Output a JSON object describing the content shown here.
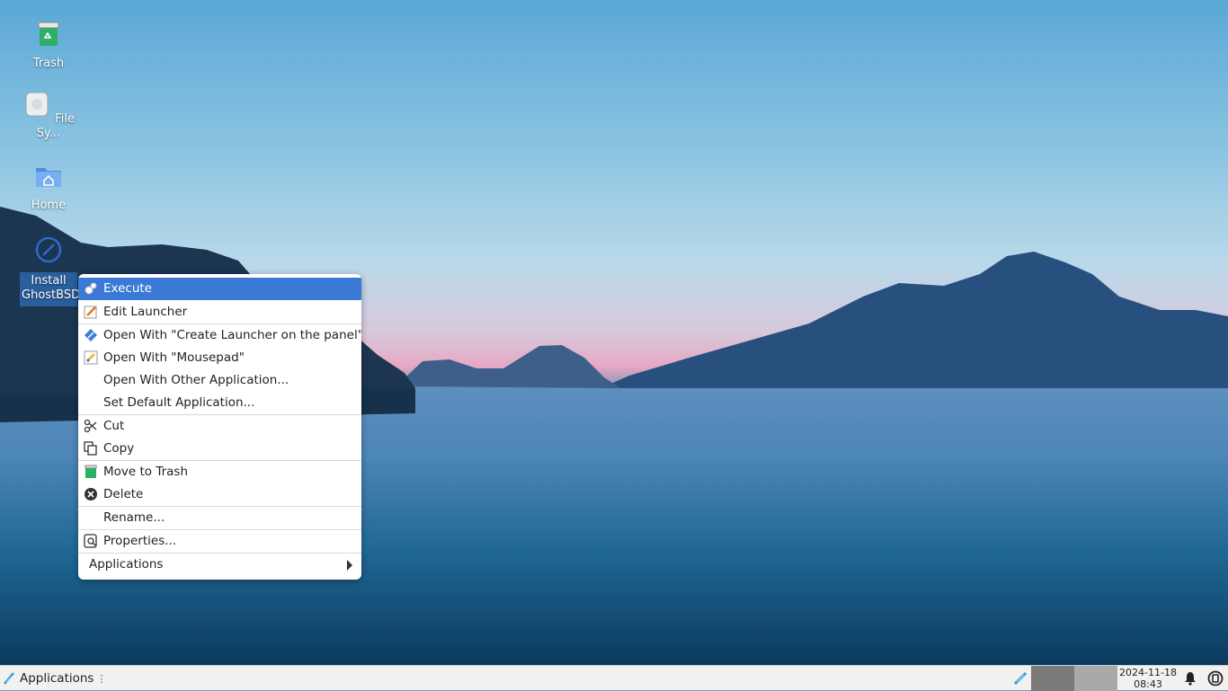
{
  "desktop": {
    "icons": [
      {
        "label": "Trash",
        "icon": "trash-icon"
      },
      {
        "label": "File Sy...",
        "icon": "drive-icon"
      },
      {
        "label": "Home",
        "icon": "home-folder-icon"
      },
      {
        "label": "Install GhostBSD",
        "icon": "ghostbsd-installer-icon",
        "selected": true
      }
    ]
  },
  "context_menu": {
    "items": [
      {
        "label": "Execute",
        "icon": "gears-icon",
        "highlighted": true
      },
      {
        "label": "Edit Launcher",
        "icon": "edit-icon"
      },
      {
        "label": "Open With \"Create Launcher on the panel\"",
        "icon": "launcher-icon"
      },
      {
        "label": "Open With \"Mousepad\"",
        "icon": "mousepad-icon"
      },
      {
        "label": "Open With Other Application...",
        "icon": ""
      },
      {
        "label": "Set Default Application...",
        "icon": ""
      },
      {
        "label": "Cut",
        "icon": "scissors-icon"
      },
      {
        "label": "Copy",
        "icon": "copy-icon"
      },
      {
        "label": "Move to Trash",
        "icon": "trash-icon"
      },
      {
        "label": "Delete",
        "icon": "delete-icon"
      },
      {
        "label": "Rename...",
        "icon": ""
      },
      {
        "label": "Properties...",
        "icon": "properties-icon"
      },
      {
        "label": "Applications",
        "icon": "submenu-arrow-icon"
      }
    ]
  },
  "taskbar": {
    "apps_label": "Applications",
    "date": "2024-11-18",
    "time": "08:43"
  },
  "colors": {
    "menu_highlight": "#3a7ad6",
    "selection": "#2a5f9e",
    "taskbar": "#f2f1f0"
  }
}
